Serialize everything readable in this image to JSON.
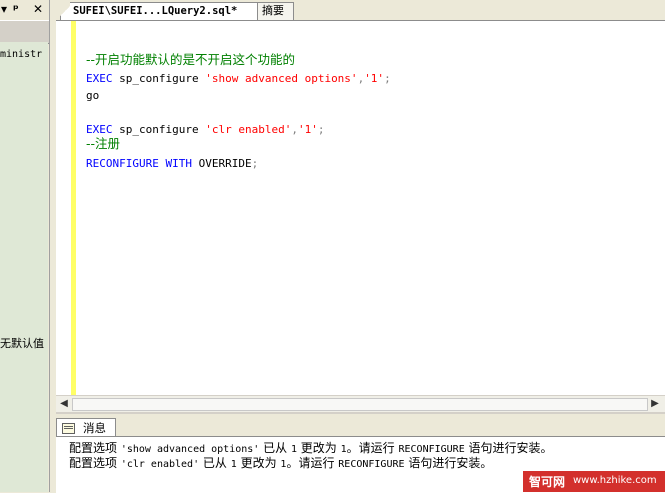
{
  "left_panel": {
    "pin_glyph": "ד",
    "pin_symbol": "Ш",
    "close_glyph": "✕",
    "tree": {
      "node_partial": "ministr",
      "node_label_2": "无默认值"
    }
  },
  "tabs": [
    {
      "label": "SUFEI\\SUFEI...LQuery2.sql*",
      "active": true
    },
    {
      "label": "摘要",
      "active": false
    }
  ],
  "editor": {
    "lines": {
      "comment1": "--开启功能默认的是不开启这个功能的",
      "exec": "EXEC",
      "sp_configure": "sp_configure",
      "show_opt": "'show advanced options'",
      "comma": ",",
      "one": "'1'",
      "semicolon": ";",
      "go": "go",
      "clr_opt": "'clr enabled'",
      "comment2": "--注册",
      "reconfigure": "RECONFIGURE",
      "with": "WITH",
      "override": "OVERRIDE"
    },
    "colors": {
      "keyword": "#0000ff",
      "string": "#ff0000",
      "comment": "#008000",
      "change_bar": "#ffff66"
    }
  },
  "results": {
    "tab_label": "消息",
    "messages": [
      {
        "pre": "配置选项 ",
        "option": "'show advanced options'",
        "mid": " 已从 ",
        "from": "1",
        "mid2": " 更改为 ",
        "to": "1",
        "post": "。请运行 ",
        "cmd": "RECONFIGURE",
        "tail": " 语句进行安装。"
      },
      {
        "pre": "配置选项 ",
        "option": "'clr enabled'",
        "mid": " 已从 ",
        "from": "1",
        "mid2": " 更改为 ",
        "to": "1",
        "post": "。请运行 ",
        "cmd": "RECONFIGURE",
        "tail": " 语句进行安装。"
      }
    ]
  },
  "watermark": {
    "name": "智可网",
    "url": "www.hzhike.com"
  }
}
